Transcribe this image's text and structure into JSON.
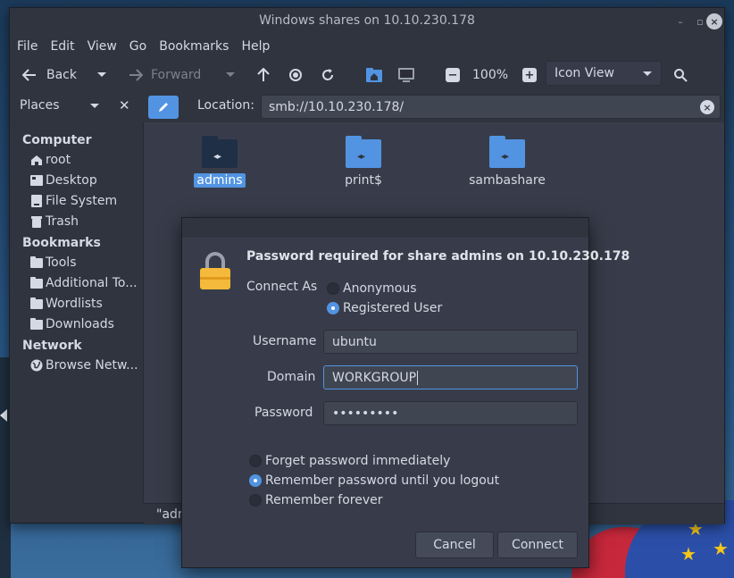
{
  "window": {
    "title": "Windows shares on 10.10.230.178"
  },
  "menubar": [
    "File",
    "Edit",
    "View",
    "Go",
    "Bookmarks",
    "Help"
  ],
  "toolbar": {
    "back": "Back",
    "forward": "Forward",
    "zoom": "100%",
    "view_mode": "Icon View"
  },
  "location": {
    "label": "Location:",
    "value": "smb://10.10.230.178/"
  },
  "sidebar": {
    "header": "Places",
    "sections": {
      "computer": "Computer",
      "bookmarks": "Bookmarks",
      "network": "Network"
    },
    "computer_items": [
      "root",
      "Desktop",
      "File System",
      "Trash"
    ],
    "bookmark_items": [
      "Tools",
      "Additional To...",
      "Wordlists",
      "Downloads"
    ],
    "network_items": [
      "Browse Netw..."
    ]
  },
  "files": [
    {
      "name": "admins",
      "selected": true
    },
    {
      "name": "print$",
      "selected": false
    },
    {
      "name": "sambashare",
      "selected": false
    }
  ],
  "statusbar": {
    "text": "\"adm"
  },
  "dialog": {
    "heading": "Password required for share admins on 10.10.230.178",
    "connect_as_label": "Connect As",
    "connect_as_options": [
      "Anonymous",
      "Registered User"
    ],
    "connect_as_selected": "Registered User",
    "username_label": "Username",
    "username_value": "ubuntu",
    "domain_label": "Domain",
    "domain_value": "WORKGROUP",
    "password_label": "Password",
    "password_value": "•••••••••",
    "remember_options": [
      "Forget password immediately",
      "Remember password until you logout",
      "Remember forever"
    ],
    "remember_selected": "Remember password until you logout",
    "cancel_label": "Cancel",
    "connect_label": "Connect"
  },
  "colors": {
    "accent": "#5294e2",
    "window_bg": "#2f343f",
    "content_bg": "#383c4a",
    "lock": "#f5b93b"
  }
}
